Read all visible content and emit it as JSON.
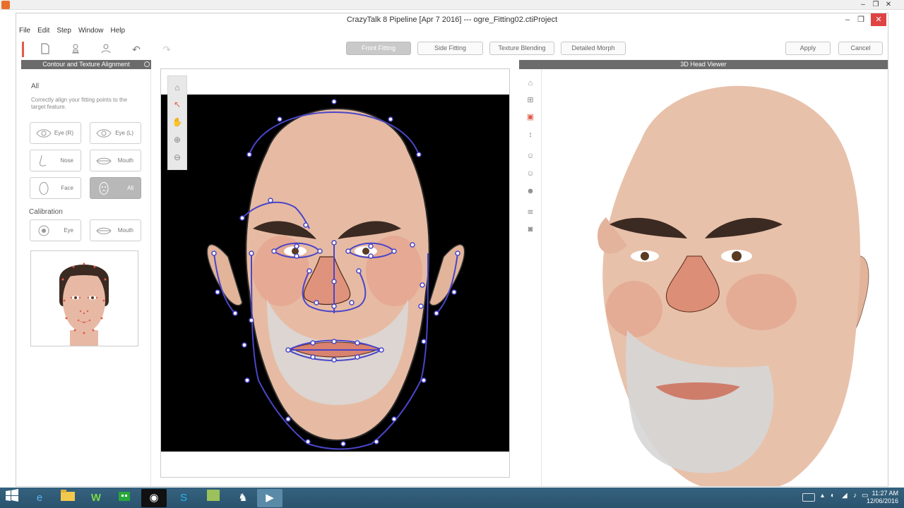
{
  "app": {
    "title": "CrazyTalk 8 Pipeline [Apr  7 2016] --- ogre_Fitting02.ctiProject",
    "menu": [
      "File",
      "Edit",
      "Step",
      "Window",
      "Help"
    ]
  },
  "toolbar": {
    "stages": [
      "Front Fitting",
      "Side Fitting",
      "Texture Blending",
      "Detailed Morph"
    ],
    "active_stage": "Front Fitting",
    "apply_label": "Apply",
    "cancel_label": "Cancel"
  },
  "left_panel": {
    "header": "Contour and Texture Alignment",
    "section_title": "All",
    "description": "Correctly align your fitting points to the target feature.",
    "parts": [
      {
        "label": "Eye (R)",
        "icon": "eye-icon"
      },
      {
        "label": "Eye (L)",
        "icon": "eye-icon"
      },
      {
        "label": "Nose",
        "icon": "nose-icon"
      },
      {
        "label": "Mouth",
        "icon": "mouth-icon"
      },
      {
        "label": "Face",
        "icon": "face-icon"
      },
      {
        "label": "All",
        "icon": "head-icon",
        "active": true
      }
    ],
    "calibration_title": "Calibration",
    "calibration": [
      {
        "label": "Eye",
        "icon": "eye-calibration-icon"
      },
      {
        "label": "Mouth",
        "icon": "mouth-icon"
      }
    ]
  },
  "viewer": {
    "header": "3D Head Viewer"
  },
  "taskbar": {
    "time": "11:27 AM",
    "date": "12/06/2016"
  },
  "colors": {
    "accent": "#e25b4b",
    "fit_line": "#4a45c8",
    "panel_header": "#6b6b6b",
    "taskbar": "#2e5a77"
  }
}
